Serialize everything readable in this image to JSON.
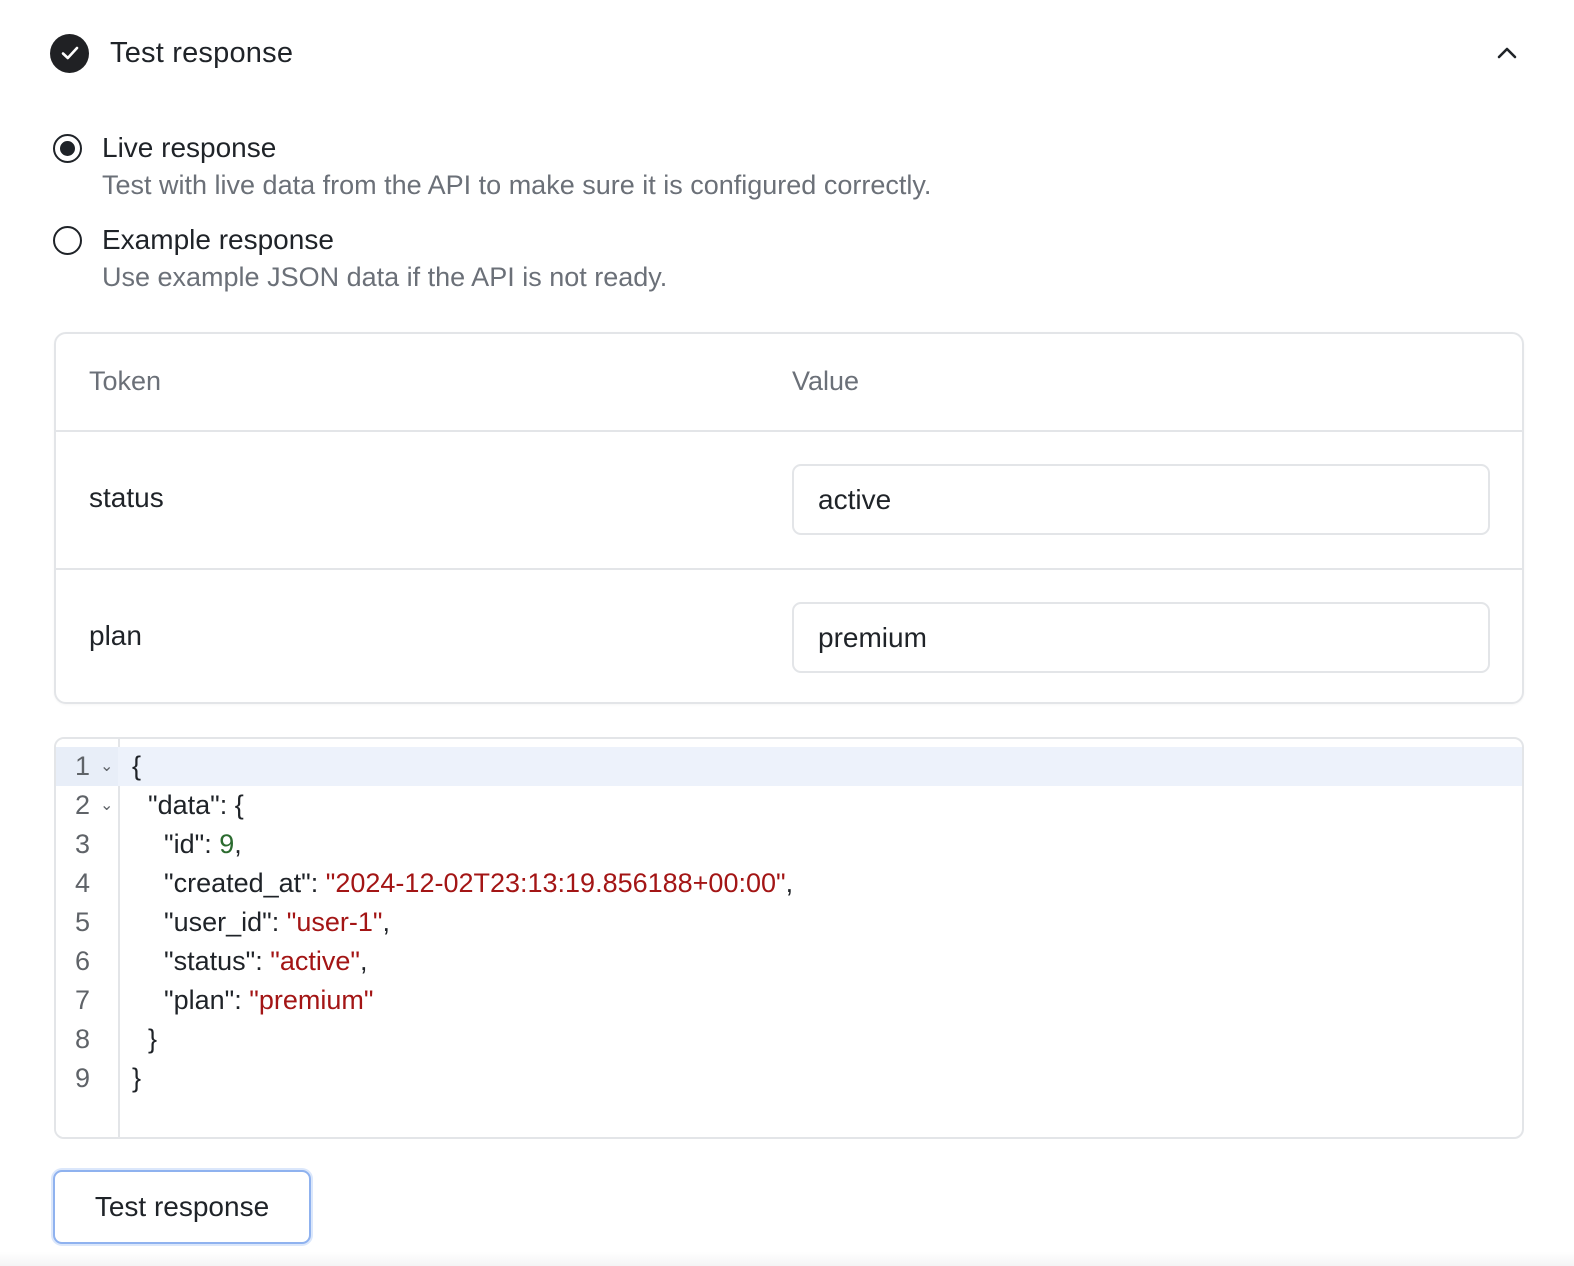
{
  "section": {
    "title": "Test response",
    "status_icon": "check-circle-icon",
    "collapse_icon": "chevron-up-icon",
    "expanded": true
  },
  "response_mode": {
    "selected": "live",
    "options": [
      {
        "id": "live",
        "label": "Live response",
        "description": "Test with live data from the API to make sure it is configured correctly."
      },
      {
        "id": "example",
        "label": "Example response",
        "description": "Use example JSON data if the API is not ready."
      }
    ]
  },
  "token_table": {
    "headers": {
      "token": "Token",
      "value": "Value"
    },
    "rows": [
      {
        "token": "status",
        "value": "active"
      },
      {
        "token": "plan",
        "value": "premium"
      }
    ]
  },
  "code_editor": {
    "active_line": 1,
    "lines": [
      {
        "number": "1",
        "foldable": true,
        "indent": 0,
        "tokens": [
          {
            "t": "punc",
            "v": "{"
          }
        ]
      },
      {
        "number": "2",
        "foldable": true,
        "indent": 1,
        "tokens": [
          {
            "t": "key",
            "v": "\"data\""
          },
          {
            "t": "punc",
            "v": ": {"
          }
        ]
      },
      {
        "number": "3",
        "foldable": false,
        "indent": 2,
        "tokens": [
          {
            "t": "key",
            "v": "\"id\""
          },
          {
            "t": "punc",
            "v": ": "
          },
          {
            "t": "num",
            "v": "9"
          },
          {
            "t": "punc",
            "v": ","
          }
        ]
      },
      {
        "number": "4",
        "foldable": false,
        "indent": 2,
        "tokens": [
          {
            "t": "key",
            "v": "\"created_at\""
          },
          {
            "t": "punc",
            "v": ": "
          },
          {
            "t": "str",
            "v": "\"2024-12-02T23:13:19.856188+00:00\""
          },
          {
            "t": "punc",
            "v": ","
          }
        ]
      },
      {
        "number": "5",
        "foldable": false,
        "indent": 2,
        "tokens": [
          {
            "t": "key",
            "v": "\"user_id\""
          },
          {
            "t": "punc",
            "v": ": "
          },
          {
            "t": "str",
            "v": "\"user-1\""
          },
          {
            "t": "punc",
            "v": ","
          }
        ]
      },
      {
        "number": "6",
        "foldable": false,
        "indent": 2,
        "tokens": [
          {
            "t": "key",
            "v": "\"status\""
          },
          {
            "t": "punc",
            "v": ": "
          },
          {
            "t": "str",
            "v": "\"active\""
          },
          {
            "t": "punc",
            "v": ","
          }
        ]
      },
      {
        "number": "7",
        "foldable": false,
        "indent": 2,
        "tokens": [
          {
            "t": "key",
            "v": "\"plan\""
          },
          {
            "t": "punc",
            "v": ": "
          },
          {
            "t": "str",
            "v": "\"premium\""
          }
        ]
      },
      {
        "number": "8",
        "foldable": false,
        "indent": 1,
        "tokens": [
          {
            "t": "punc",
            "v": "}"
          }
        ]
      },
      {
        "number": "9",
        "foldable": false,
        "indent": 0,
        "tokens": [
          {
            "t": "punc",
            "v": "}"
          }
        ]
      }
    ]
  },
  "actions": {
    "test_button_label": "Test response"
  }
}
